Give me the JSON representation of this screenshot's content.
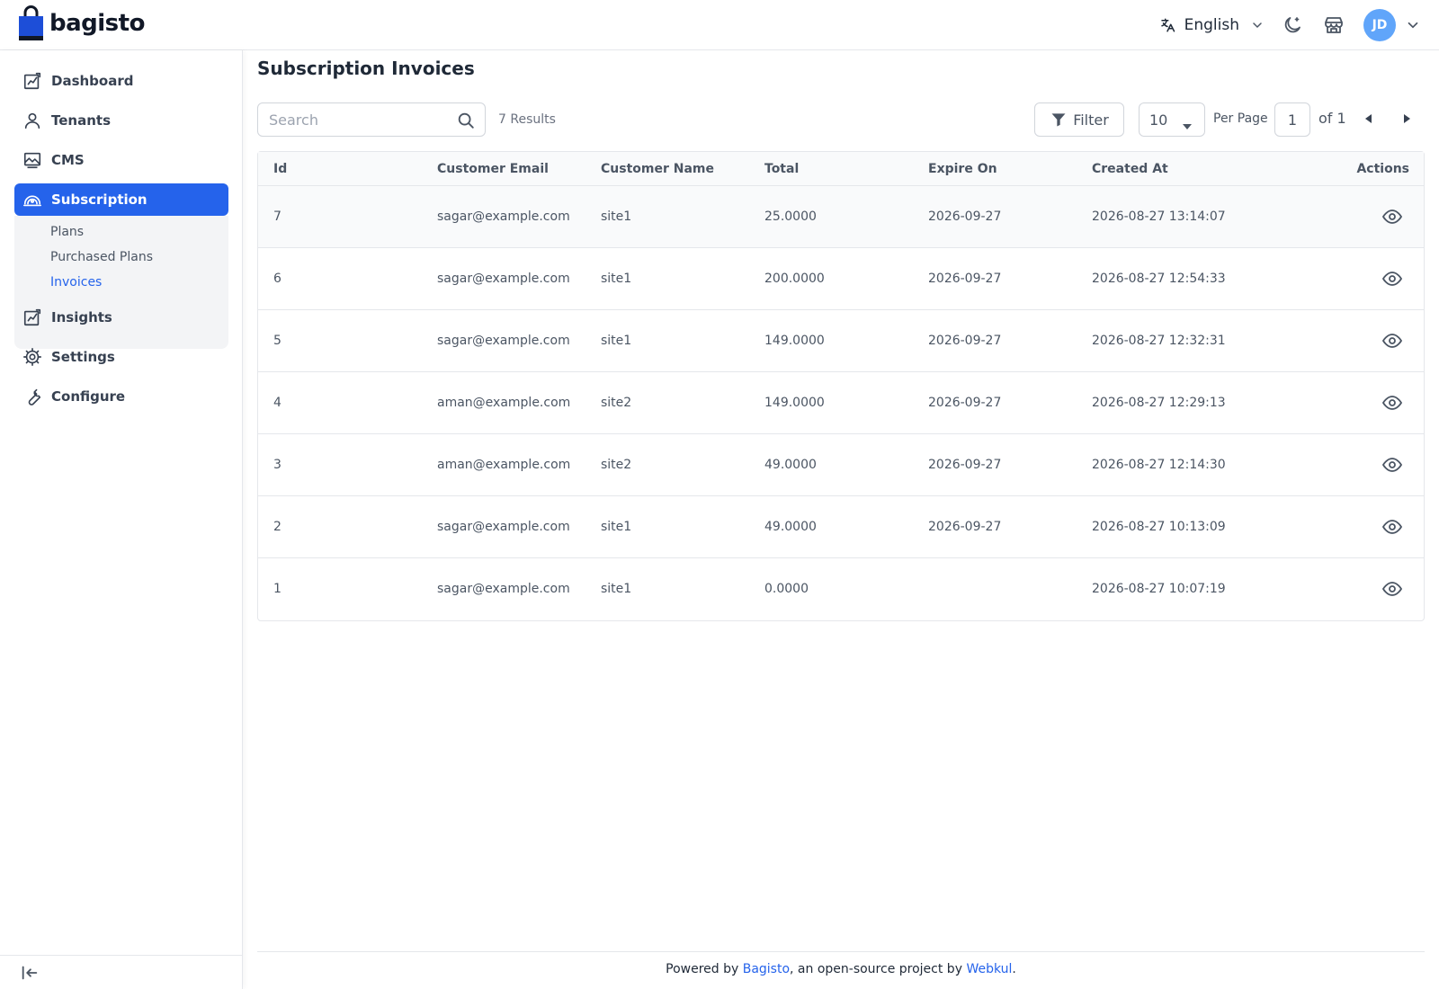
{
  "header": {
    "brand": "bagisto",
    "language": "English",
    "avatar_initials": "JD"
  },
  "sidebar": {
    "items": [
      {
        "label": "Dashboard",
        "icon": "dashboard-icon"
      },
      {
        "label": "Tenants",
        "icon": "user-icon"
      },
      {
        "label": "CMS",
        "icon": "image-icon"
      },
      {
        "label": "Subscription",
        "icon": "subscription-icon",
        "active": true
      },
      {
        "label": "Insights",
        "icon": "chart-icon"
      },
      {
        "label": "Settings",
        "icon": "gear-icon"
      },
      {
        "label": "Configure",
        "icon": "wrench-icon"
      }
    ],
    "submenu": [
      {
        "label": "Plans"
      },
      {
        "label": "Purchased Plans"
      },
      {
        "label": "Invoices",
        "active": true
      }
    ]
  },
  "main": {
    "title": "Subscription Invoices",
    "search_placeholder": "Search",
    "results": "7 Results",
    "filter_label": "Filter",
    "per_page_value": "10",
    "per_page_label": "Per Page",
    "page_value": "1",
    "page_of": "of 1"
  },
  "table": {
    "columns": [
      "Id",
      "Customer Email",
      "Customer Name",
      "Total",
      "Expire On",
      "Created At",
      "Actions"
    ],
    "rows": [
      {
        "id": "7",
        "email": "sagar@example.com",
        "name": "site1",
        "total": "25.0000",
        "expire": "2026-09-27",
        "created": "2026-08-27 13:14:07"
      },
      {
        "id": "6",
        "email": "sagar@example.com",
        "name": "site1",
        "total": "200.0000",
        "expire": "2026-09-27",
        "created": "2026-08-27 12:54:33"
      },
      {
        "id": "5",
        "email": "sagar@example.com",
        "name": "site1",
        "total": "149.0000",
        "expire": "2026-09-27",
        "created": "2026-08-27 12:32:31"
      },
      {
        "id": "4",
        "email": "aman@example.com",
        "name": "site2",
        "total": "149.0000",
        "expire": "2026-09-27",
        "created": "2026-08-27 12:29:13"
      },
      {
        "id": "3",
        "email": "aman@example.com",
        "name": "site2",
        "total": "49.0000",
        "expire": "2026-09-27",
        "created": "2026-08-27 12:14:30"
      },
      {
        "id": "2",
        "email": "sagar@example.com",
        "name": "site1",
        "total": "49.0000",
        "expire": "2026-09-27",
        "created": "2026-08-27 10:13:09"
      },
      {
        "id": "1",
        "email": "sagar@example.com",
        "name": "site1",
        "total": "0.0000",
        "expire": "",
        "created": "2026-08-27 10:07:19"
      }
    ]
  },
  "footer": {
    "prefix": "Powered by ",
    "link1": "Bagisto",
    "middle": ", an open-source project by ",
    "link2": "Webkul",
    "suffix": "."
  },
  "colors": {
    "accent": "#2563eb",
    "avatar": "#60a5fa"
  }
}
